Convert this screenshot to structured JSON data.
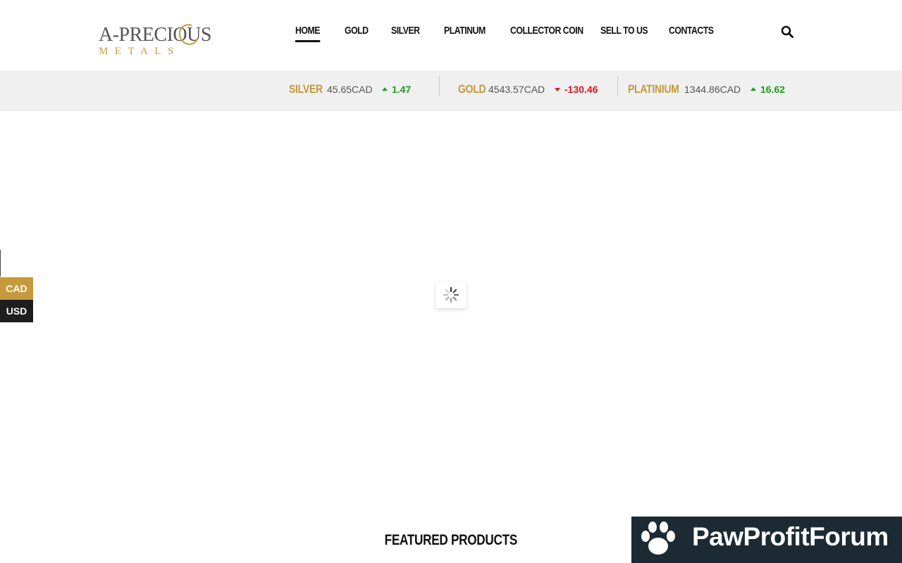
{
  "logo": {
    "line1": "A-PRECIOUS",
    "line2": "METALS"
  },
  "nav": {
    "items": [
      "HOME",
      "GOLD",
      "SILVER",
      "PLATINUM",
      "COLLECTOR COIN",
      "SELL TO US",
      "CONTACTS"
    ],
    "active": "HOME"
  },
  "ticker": [
    {
      "name": "SILVER",
      "price": "45.65CAD",
      "change": "1.47",
      "direction": "up"
    },
    {
      "name": "GOLD",
      "price": "4543.57CAD",
      "change": "-130.46",
      "direction": "down"
    },
    {
      "name": "PLATINIUM",
      "price": "1344.86CAD",
      "change": "16.62",
      "direction": "up"
    }
  ],
  "currency": {
    "options": [
      "CAD",
      "USD"
    ],
    "selected": "CAD"
  },
  "featured": {
    "title": "FEATURED PRODUCTS"
  },
  "badge": {
    "text": "PawProfitForum"
  },
  "colors": {
    "gold": "#c49a3c",
    "up": "#1aa01a",
    "down": "#e0141e",
    "ticker_bg": "#f0f0f0",
    "badge_bg": "#1b2a33"
  }
}
